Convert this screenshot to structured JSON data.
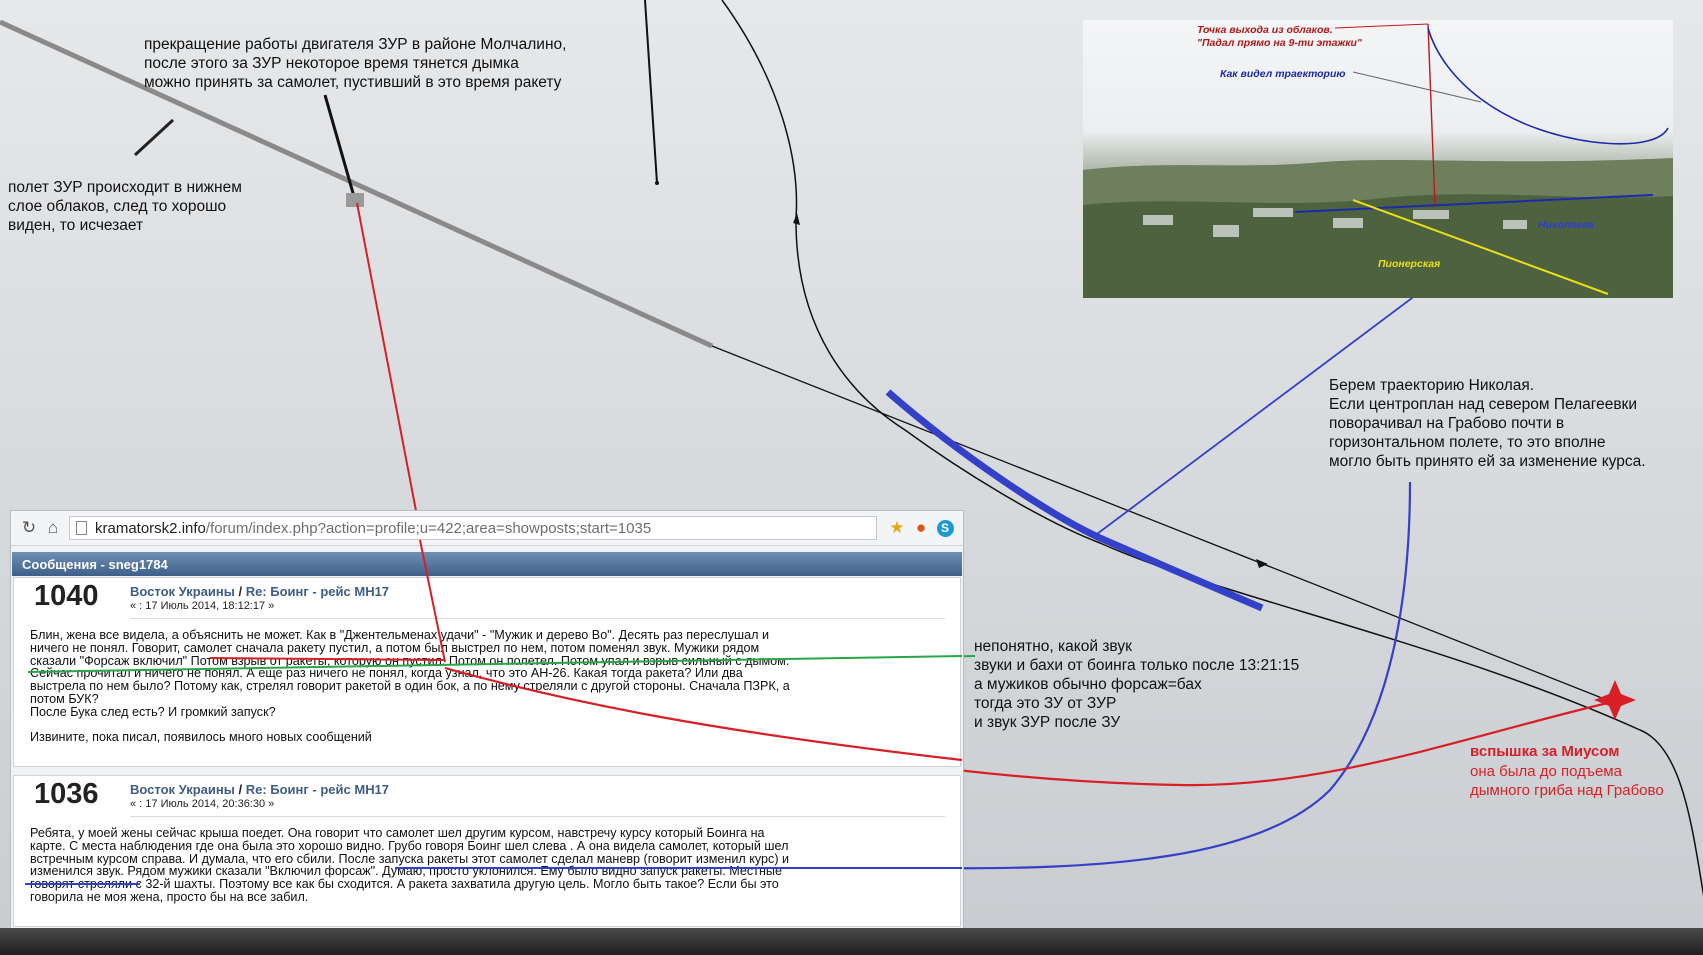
{
  "annotations": {
    "engine_cutoff": "прекращение работы двигателя ЗУР в районе Молчалино,\nпосле этого за ЗУР некоторое время тянется дымка\nможно принять за самолет, пустивший в это время ракету",
    "sam_flight": "полет ЗУР происходит в нижнем\nслое облаков, след то хорошо\nвиден, то исчезает",
    "nikolai": "Берем траекторию Николая.\nЕсли центроплан над севером Пелагеевки\nповорачивал на Грабово почти в\nгоризонтальном полете, то это вполне\nмогло быть принято ей за изменение курса.",
    "sound": "непонятно, какой звук\nзвуки и бахи от боинга только после 13:21:15\nа мужиков обычно форсаж=бах\nтогда это ЗУ от ЗУР\n и звук ЗУР после ЗУ",
    "flash_bold": "вспышка за Миусом",
    "flash_rest": "она была до подъема\nдымного гриба над Грабово"
  },
  "photo": {
    "exit_caption": "Точка выхода из облаков.\n\"Падал прямо на 9-ти этажки\"",
    "trajectory_caption": "Как видел траекторию",
    "nikolaeva_label": "Николаева",
    "pionerskaya_label": "Пионерская"
  },
  "browser": {
    "url_host": "kramatorsk2.info",
    "url_path": "/forum/index.php?action=profile;u=422;area=showposts;start=1035",
    "forum_header": "Сообщения - sneg1784"
  },
  "posts": [
    {
      "number": "1040",
      "board": "Восток Украины",
      "slash": " / ",
      "topic": "Re: Боинг - рейс МН17",
      "date": "« : 17 Июль 2014, 18:12:17 »",
      "body": "Блин, жена все видела, а объяснить не может. Как в \"Джентельменах удачи\" - \"Мужик и дерево Во\". Десять раз переслушал и\nничего не понял. Говорит, самолет сначала ракету пустил, а потом был выстрел по нем, потом поменял звук. Мужики рядом\nсказали \"Форсаж включил\" Потом взрыв от ракеты, которую он пустил. Потом он полетел. Потом упал и взрыв сильный с дымом.\nСейчас прочитал и ничего не понял. А еще раз ничего не понял, когда узнал, что это АН-26. Какая тогда ракета? Или два\nвыстрела по нем было? Потому как, стрелял говорит ракетой в один бок, а по нему стреляли с другой стороны. Сначала ПЗРК, а\nпотом БУК?\nПосле Бука след есть? И громкий запуск?\n\nИзвините, пока писал, появилось много новых сообщений"
    },
    {
      "number": "1036",
      "board": "Восток Украины",
      "slash": " / ",
      "topic": "Re: Боинг - рейс МН17",
      "date": "« : 17 Июль 2014, 20:36:30 »",
      "body": "Ребята, у моей жены сейчас крыша поедет. Она говорит что самолет шел другим курсом, навстречу курсу который Боинга на\nкарте. С места наблюдения где она была это хорошо видно. Грубо говоря Боинг шел слева . А она видела самолет, который шел\nвстречным курсом справа. И думала, что его сбили. После запуска ракеты этот самолет сделал маневр (говорит изменил курс) и\nизменился звук. Рядом мужики сказали \"Включил форсаж\". Думаю, просто уклонился. Ему было видно запуск ракеты. Местные\nговорят стреляли с 32-й шахты. Поэтому все как бы сходится. А ракета захватила другую цель. Могло быть такое? Если бы это\nговорила не моя жена, просто бы на все забил."
    }
  ],
  "colors": {
    "red": "#d81f26",
    "blue": "#3340c8",
    "green": "#2aa64a",
    "grey_trail": "#8a8a8a",
    "forum_link": "#3f5d86"
  },
  "icons": [
    "reload-icon",
    "home-icon",
    "page-icon",
    "star-icon",
    "extension-icon",
    "skype-icon",
    "flash-star-icon"
  ]
}
